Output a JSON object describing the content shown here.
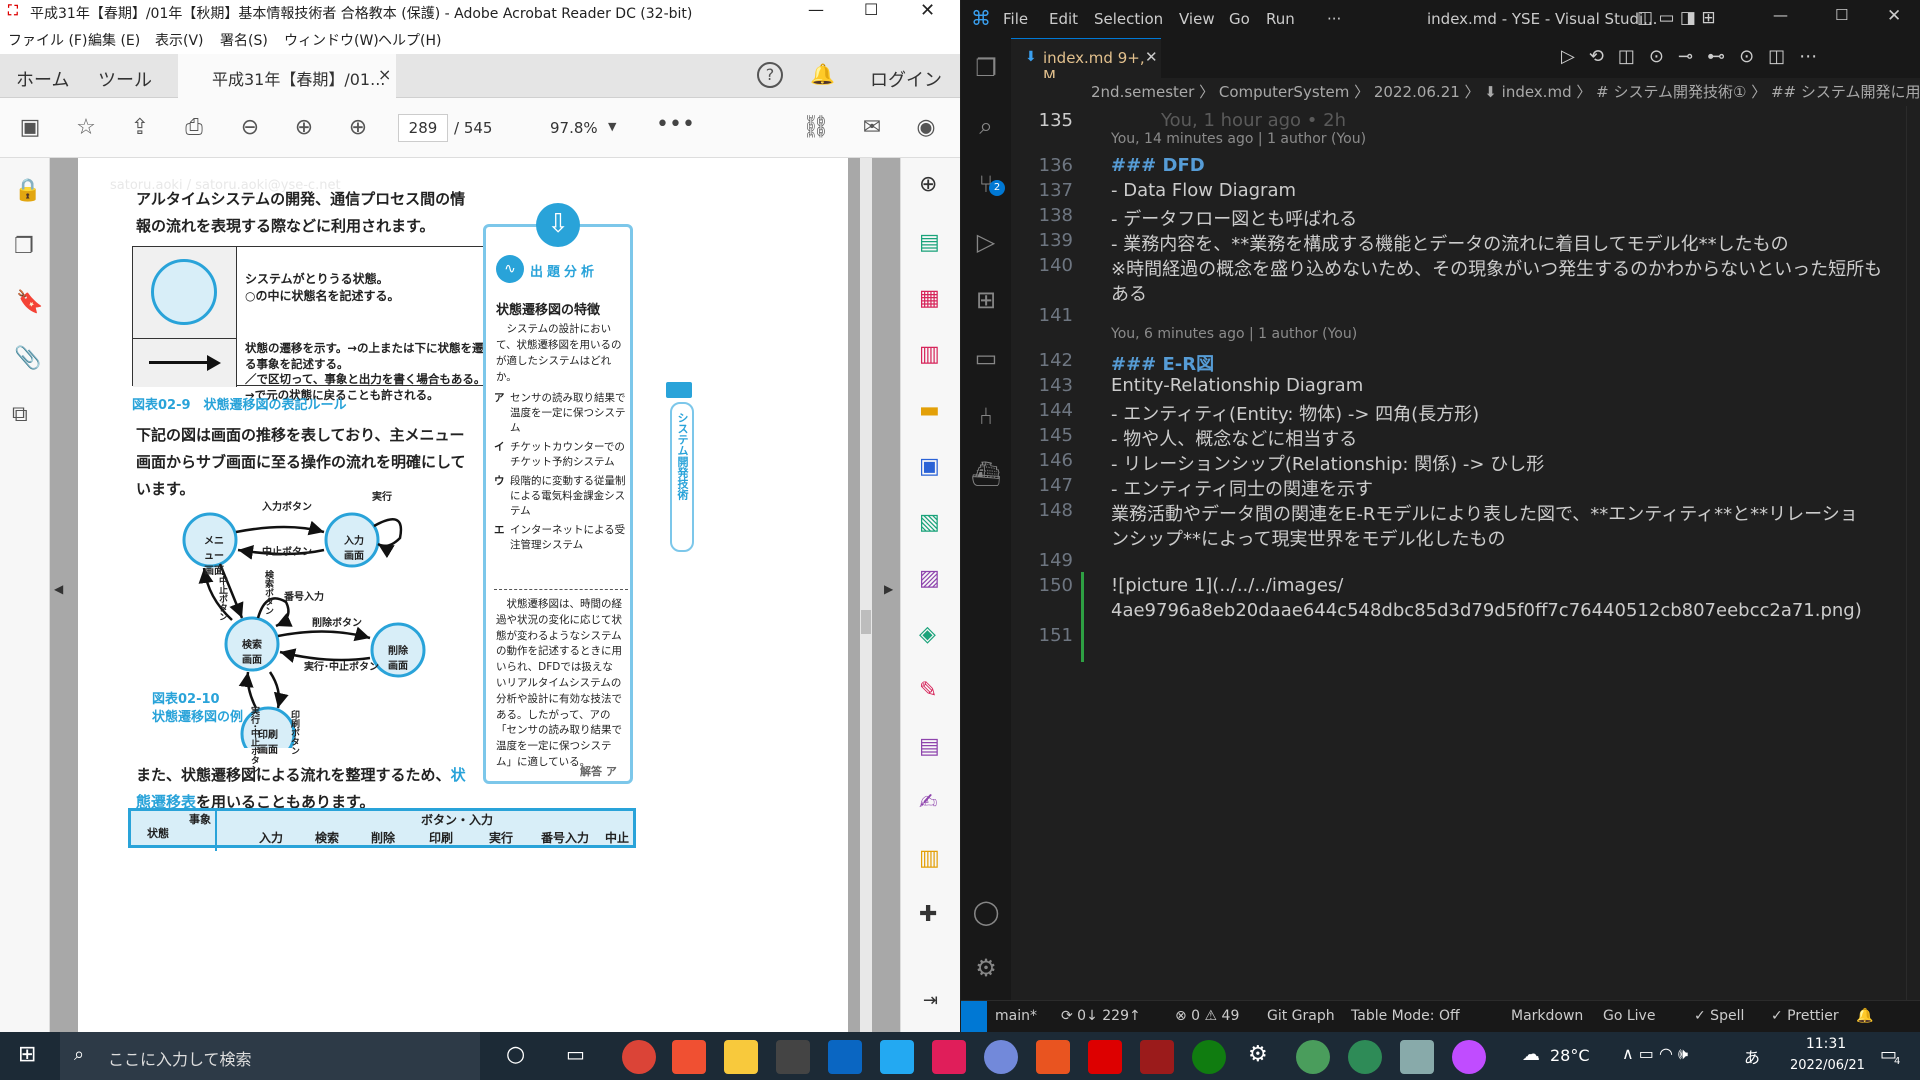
{
  "acrobat": {
    "title": "平成31年【春期】/01年【秋期】基本情報技術者 合格教本 (保護) - Adobe Acrobat Reader DC (32-bit)",
    "menu": [
      "ファイル (F)",
      "編集 (E)",
      "表示(V)",
      "署名(S)",
      "ウィンドウ(W)",
      "ヘルプ(H)"
    ],
    "tabs": {
      "home": "ホーム",
      "tools": "ツール",
      "doc": "平成31年【春期】/01...",
      "close": "×",
      "login": "ログイン"
    },
    "toolbar": {
      "page": "289",
      "total": "/ 545",
      "zoom": "97.8%"
    },
    "page": {
      "watermark": "satoru.aoki / satoru.aoki@yse-c.net",
      "p1": "アルタイムシステムの開発、通信プロセス間の情報の流れを表現する際などに利用されます。",
      "table_row1": "システムがとりうる状態。\n○の中に状態名を記述する。",
      "table_row2": "状態の遷移を示す。→の上または下に状態を遷移させる事象を記述する。\n／で区切って、事象と出力を書く場合もある。\n→で元の状態に戻ることも許される。",
      "fig1": "図表02-9　状態遷移図の表記ルール",
      "p2": "下記の図は画面の推移を表しており、主メニュー画面からサブ画面に至る操作の流れを明確にしています。",
      "fig2a": "図表02-10",
      "fig2b": "状態遷移図の例",
      "p3a": "また、状態遷移図による流れを整理するため、",
      "p3link": "状態遷移表",
      "p3b": "を用いることもあります。",
      "nodes": [
        "メニュー画面",
        "入力画面",
        "検索画面",
        "削除画面",
        "印刷画面"
      ],
      "edges": [
        "入力ボタン",
        "中止ボタン",
        "実行",
        "検索ボタン",
        "番号入力",
        "中止ボタン",
        "削除ボタン",
        "実行･中止ボタン",
        "実行･中止ボタン",
        "印刷ボタン"
      ],
      "table_hdr": [
        "事象",
        "ボタン・入力",
        "状態",
        "入力",
        "検索",
        "削除",
        "印刷",
        "実行",
        "番号入力",
        "中止"
      ],
      "side": {
        "label": "出題分析",
        "title": "状態遷移図の特徴",
        "q": "システムの設計において、状態遷移図を用いるのが適したシステムはどれか。",
        "opts": [
          [
            "ア",
            "センサの読み取り結果で温度を一定に保つシステム"
          ],
          [
            "イ",
            "チケットカウンターでのチケット予約システム"
          ],
          [
            "ウ",
            "段階的に変動する従量制による電気料金課金システム"
          ],
          [
            "エ",
            "インターネットによる受注管理システム"
          ]
        ],
        "exp": "状態遷移図は、時間の経過や状況の変化に応じて状態が変わるようなシステムの動作を記述するときに用いられ、DFDでは扱えないリアルタイムシステムの分析や設計に有効な技法である。したがって、アの「センサの読み取り結果で温度を一定に保つシステム」に適している。",
        "ans": "解答 ア",
        "vtab": "システム開発技術"
      }
    }
  },
  "vscode": {
    "menu": [
      "File",
      "Edit",
      "Selection",
      "View",
      "Go",
      "Run",
      "···"
    ],
    "title": "index.md - YSE - Visual Studi...",
    "tab": "index.md 9+, M",
    "breadcrumb": "2nd.semester  〉 ComputerSystem 〉 2022.06.21 〉 ⬇ index.md 〉 # システム開発技術① 〉 ## システム開発に用いる图",
    "lines": [
      {
        "n": "135",
        "t": "",
        "ghost": "You, 1 hour ago • 2h"
      },
      {
        "blame": "You, 14 minutes ago | 1 author (You)"
      },
      {
        "n": "136",
        "t": "### DFD"
      },
      {
        "n": "137",
        "t": "- Data Flow Diagram"
      },
      {
        "n": "138",
        "t": "- データフロー図とも呼ばれる"
      },
      {
        "n": "139",
        "t": "- 業務内容を、**業務を構成する機能とデータの流れに着目してモデル化**したもの"
      },
      {
        "n": "140",
        "t": "※時間経過の概念を盛り込めないため、その現象がいつ発生するのかわからないといった短所も"
      },
      {
        "n": "",
        "t": "ある"
      },
      {
        "n": "141",
        "t": ""
      },
      {
        "blame": "You, 6 minutes ago | 1 author (You)"
      },
      {
        "n": "142",
        "t": "### E-R図"
      },
      {
        "n": "143",
        "t": "Entity-Relationship Diagram"
      },
      {
        "n": "144",
        "t": "- エンティティ(Entity: 物体) -> 四角(長方形)"
      },
      {
        "n": "145",
        "t": "  - 物や人、概念などに相当する"
      },
      {
        "n": "146",
        "t": "- リレーションシップ(Relationship: 関係) -> ひし形"
      },
      {
        "n": "147",
        "t": "  - エンティティ同士の関連を示す"
      },
      {
        "n": "148",
        "t": "業務活動やデータ間の関連をE-Rモデルにより表した図で、**エンティティ**と**リレーショ"
      },
      {
        "n": "",
        "t": "ンシップ**によって現実世界をモデル化したもの"
      },
      {
        "n": "149",
        "t": ""
      },
      {
        "n": "150",
        "t": "![picture 1](../../../images/"
      },
      {
        "n": "",
        "t": "4ae9796a8eb20daae644c548dbc85d3d79d5f0ff7c76440512cb807eebcc2a71.png)"
      },
      {
        "n": "151",
        "t": ""
      }
    ],
    "status": [
      "main*",
      "⟳ 0↓ 229↑",
      "⊗ 0 ⚠ 49",
      "Git Graph",
      "Table Mode: Off",
      "Markdown",
      "Go Live",
      "✓ Spell",
      "✓ Prettier"
    ]
  },
  "taskbar": {
    "search": "ここに入力して検索",
    "temp": "28°C",
    "time": "11:31",
    "date": "2022/06/21",
    "ime": "あ",
    "notif": "4"
  }
}
